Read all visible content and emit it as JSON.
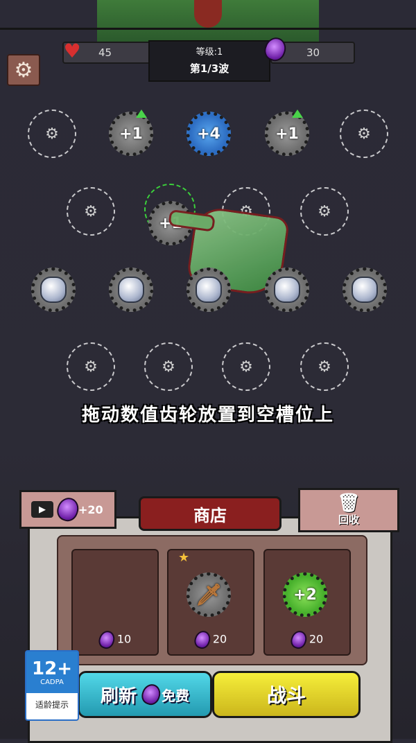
{
  "hud": {
    "health": "45",
    "gems": "30",
    "level": "等级:1",
    "wave": "第1/3波"
  },
  "grid": {
    "row1": [
      {
        "type": "empty"
      },
      {
        "type": "gear",
        "color": "grey",
        "value": "+1",
        "upgrade": true
      },
      {
        "type": "gear",
        "color": "blue",
        "value": "+4",
        "upgrade": false
      },
      {
        "type": "gear",
        "color": "grey",
        "value": "+1",
        "upgrade": true
      },
      {
        "type": "empty"
      }
    ],
    "row2": [
      {
        "type": "empty"
      },
      {
        "type": "gear",
        "color": "grey",
        "value": "+1",
        "dragging": true
      },
      {
        "type": "empty"
      },
      {
        "type": "empty"
      }
    ],
    "row3": [
      "crystal",
      "crystal",
      "crystal",
      "crystal",
      "crystal"
    ],
    "row4": [
      "empty",
      "empty",
      "empty",
      "empty"
    ]
  },
  "hint": "拖动数值齿轮放置到空槽位上",
  "shop": {
    "title": "商店",
    "video_reward": "+20",
    "recycle_label": "回收",
    "items": [
      {
        "price": "10",
        "content": "empty"
      },
      {
        "price": "20",
        "content": "sword-gear",
        "starred": true
      },
      {
        "price": "20",
        "content": "gear",
        "value": "+2",
        "color": "green"
      }
    ],
    "refresh_label": "刷新",
    "refresh_cost": "免费",
    "fight_label": "战斗"
  },
  "age_rating": {
    "rating": "12+",
    "org": "CADPA",
    "label": "适龄提示"
  },
  "colors": {
    "background": "#2b2a36",
    "gem": "#8a3fd1",
    "refresh": "#3cc4d6",
    "fight": "#e8dc2e"
  }
}
